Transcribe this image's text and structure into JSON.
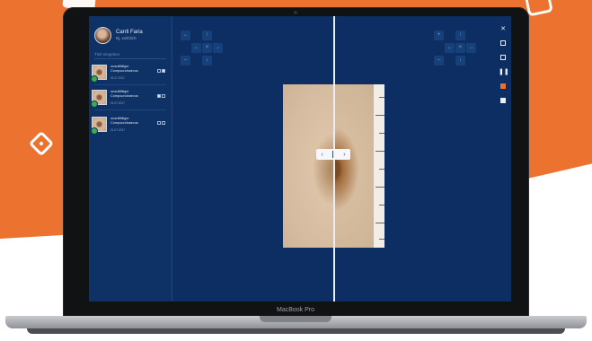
{
  "device": {
    "brand_label": "MacBook Pro"
  },
  "user": {
    "name": "Carrli Faria",
    "role": "Bj, weiblich"
  },
  "filter": {
    "placeholder": "Titel eingeben"
  },
  "items": [
    {
      "title": "unauffälliger Compoundnaevus",
      "date": "01.07.2017",
      "check1": false,
      "check2": false
    },
    {
      "title": "unauffälliger Compoundnaevus",
      "date": "01.07.2017",
      "check1": true,
      "check2": false
    },
    {
      "title": "unauffälliger Compoundnaevus",
      "date": "01.07.2017",
      "check1": false,
      "check2": false
    }
  ],
  "icons": {
    "close": "close-icon",
    "copy": "copy-icon",
    "image": "image-icon",
    "split": "split-view-icon",
    "color": "color-icon",
    "info": "info-icon"
  },
  "colors": {
    "brand_orange": "#ec7230",
    "app_background": "#0c2e63",
    "badge_green": "#3cae4a"
  }
}
